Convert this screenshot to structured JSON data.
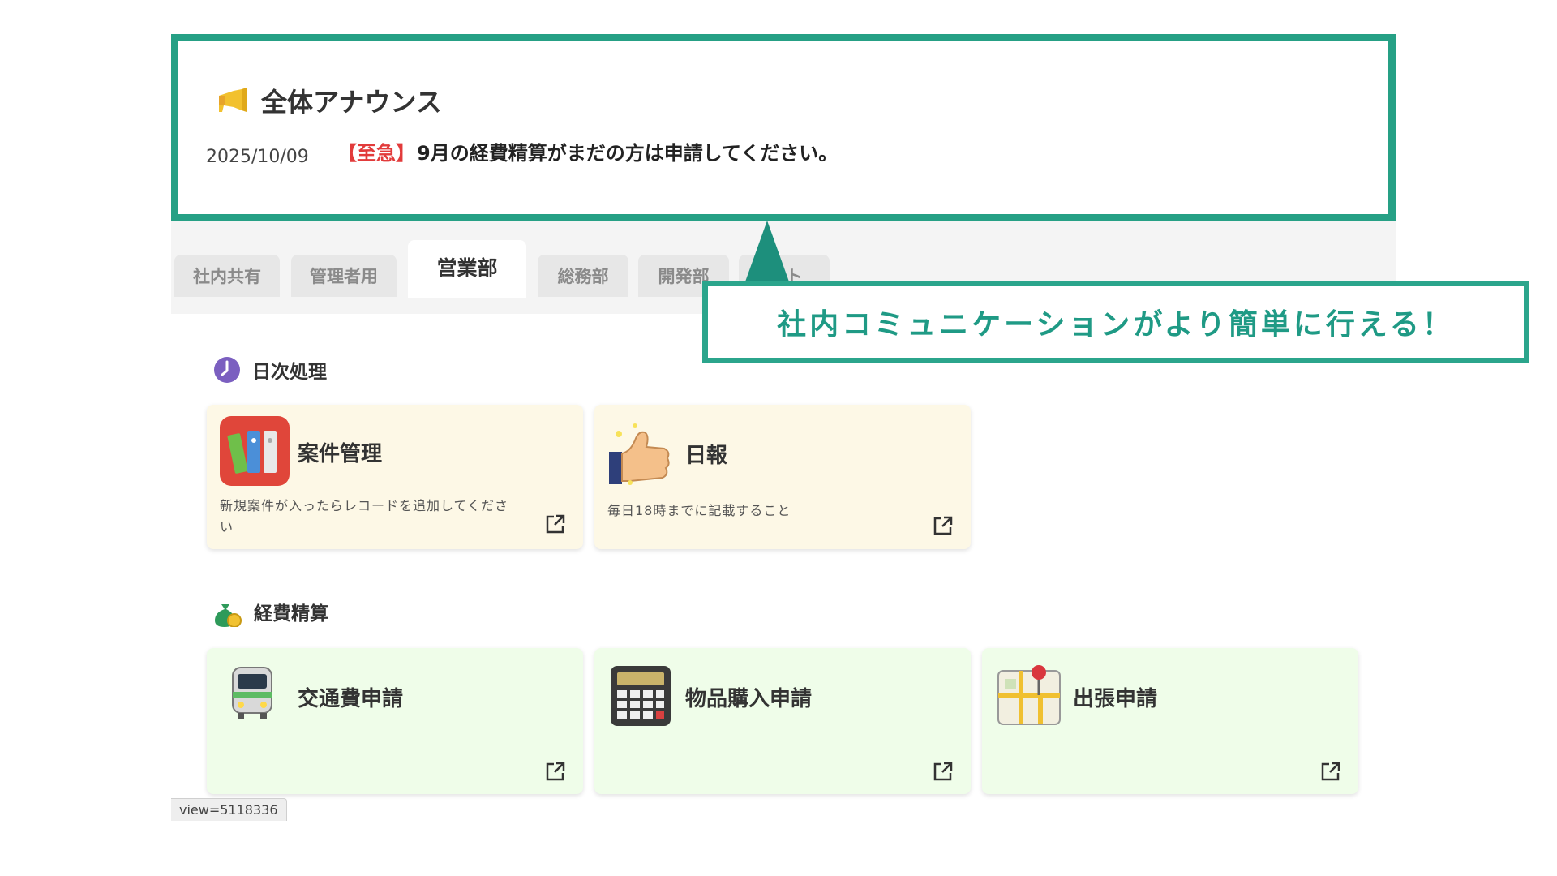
{
  "announcement": {
    "title": "全体アナウンス",
    "date": "2025/10/09",
    "urgent_tag": "【至急】",
    "message": "9月の経費精算がまだの方は申請してください。",
    "icon": "megaphone-icon"
  },
  "callout": {
    "text": "社内コミュニケーションがより簡単に行える！"
  },
  "tabs": [
    {
      "label": "社内共有",
      "active": false
    },
    {
      "label": "管理者用",
      "active": false
    },
    {
      "label": "営業部",
      "active": true
    },
    {
      "label": "総務部",
      "active": false
    },
    {
      "label": "開発部",
      "active": false
    },
    {
      "label": "...ト",
      "active": false
    }
  ],
  "sections": {
    "daily": {
      "title": "日次処理",
      "icon": "clock-icon",
      "cards": [
        {
          "title": "案件管理",
          "desc_line1": "新規案件が入ったらレコードを追加してくださ",
          "desc_line2": "い",
          "icon": "binders-icon"
        },
        {
          "title": "日報",
          "desc": "毎日18時までに記載すること",
          "icon": "thumbs-up-icon"
        }
      ]
    },
    "expense": {
      "title": "経費精算",
      "icon": "money-bag-icon",
      "cards": [
        {
          "title": "交通費申請",
          "icon": "train-icon"
        },
        {
          "title": "物品購入申請",
          "icon": "calculator-icon"
        },
        {
          "title": "出張申請",
          "icon": "map-pin-icon"
        }
      ]
    }
  },
  "status_url": "view=5118336",
  "colors": {
    "accent_teal": "#26a085",
    "urgent_red": "#e23b3b",
    "yellow_card": "#fdf8e6",
    "green_card": "#effde9"
  }
}
